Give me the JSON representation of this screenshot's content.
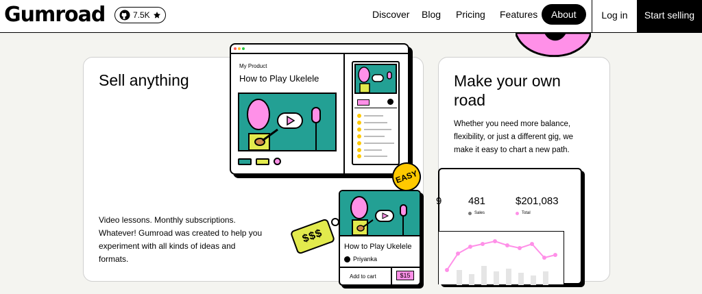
{
  "header": {
    "logo": "Gumroad",
    "github_stars": "7.5K",
    "nav": [
      "Discover",
      "Blog",
      "Pricing",
      "Features",
      "About"
    ],
    "login": "Log in",
    "start": "Start selling"
  },
  "sell_card": {
    "title": "Sell anything",
    "description": "Video lessons. Monthly subscriptions. Whatever! Gumroad was created to help you experiment with all kinds of ideas and formats.",
    "mock_label": "My Product",
    "mock_title": "How to Play Ukelele",
    "easy_sticker": "EASY",
    "tag_text": "$$$",
    "product": {
      "title": "How to Play Ukelele",
      "author": "Priyanka",
      "cta": "Add to cart",
      "price": "$15"
    }
  },
  "road_card": {
    "title": "Make your own road",
    "description": "Whether you need more balance, flexibility, or just a different gig, we make it easy to chart a new path.",
    "stats": {
      "cut_value": "9",
      "sales_value": "481",
      "sales_label": "Sales",
      "total_value": "$201,083",
      "total_label": "Total"
    }
  },
  "colors": {
    "pink": "#ff90e8",
    "teal": "#23a094",
    "yellow": "#ffc900",
    "lime": "#e2ea4d"
  }
}
